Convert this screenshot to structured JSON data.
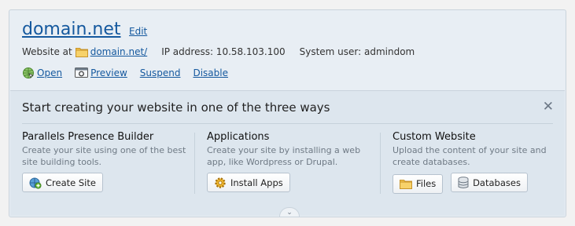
{
  "header": {
    "domain": "domain.net",
    "edit_label": "Edit",
    "website_at_label": "Website at",
    "website_link": "domain.net/",
    "ip_label": "IP address: 10.58.103.100",
    "system_user_label": "System user: admindom"
  },
  "actions": [
    {
      "label": "Open",
      "icon": "globe-icon"
    },
    {
      "label": "Preview",
      "icon": "preview-icon"
    },
    {
      "label": "Suspend",
      "icon": null
    },
    {
      "label": "Disable",
      "icon": null
    }
  ],
  "starter": {
    "title": "Start creating your website in one of the three ways",
    "close_glyph": "✕",
    "columns": [
      {
        "title": "Parallels Presence Builder",
        "desc": "Create your site using one of the best site building tools.",
        "buttons": [
          {
            "label": "Create Site",
            "icon": "presence-builder-icon"
          }
        ]
      },
      {
        "title": "Applications",
        "desc": "Create your site by installing a web app, like Wordpress or Drupal.",
        "buttons": [
          {
            "label": "Install Apps",
            "icon": "gear-icon"
          }
        ]
      },
      {
        "title": "Custom Website",
        "desc": "Upload the content of your site and create databases.",
        "buttons": [
          {
            "label": "Files",
            "icon": "folder-icon"
          },
          {
            "label": "Databases",
            "icon": "database-icon"
          }
        ]
      }
    ],
    "expand_glyph": "⌄"
  },
  "colors": {
    "link": "#14589e",
    "panel_bg": "#e8eef4",
    "starter_bg": "#dde6ee"
  }
}
